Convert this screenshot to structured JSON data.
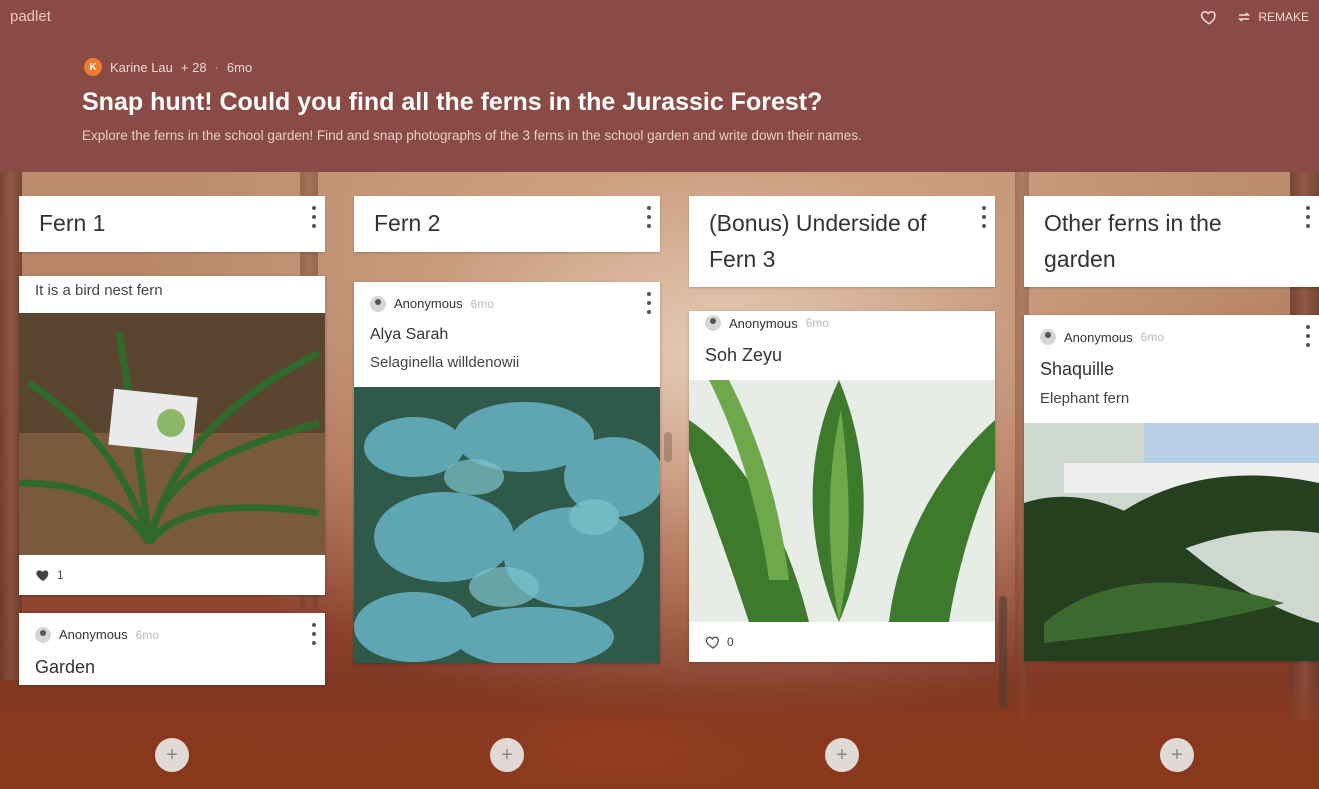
{
  "header": {
    "brand": "padlet",
    "remake_label": "REMAKE",
    "author": {
      "initial": "K",
      "name": "Karine Lau",
      "likes": "+ 28",
      "sep": "·",
      "age": "6mo"
    },
    "title": "Snap hunt! Could you find all the ferns in the Jurassic Forest?",
    "description": "Explore the ferns in the school garden! Find and snap photographs of the 3 ferns in the school garden and write down their names."
  },
  "columns": [
    {
      "title": "Fern 1",
      "cards": [
        {
          "body": "It is a bird nest fern",
          "likes": "1"
        },
        {
          "author": "Anonymous",
          "time": "6mo",
          "title": "Garden"
        }
      ]
    },
    {
      "title": "Fern 2",
      "cards": [
        {
          "author": "Anonymous",
          "time": "6mo",
          "title": "Alya Sarah",
          "body": "Selaginella willdenowii"
        }
      ]
    },
    {
      "title": "(Bonus) Underside of Fern 3",
      "cards": [
        {
          "author": "Anonymous",
          "time": "6mo",
          "title": "Soh Zeyu",
          "likes": "0"
        }
      ]
    },
    {
      "title": "Other ferns in the garden",
      "cards": [
        {
          "author": "Anonymous",
          "time": "6mo",
          "title": "Shaquille",
          "body": "Elephant fern"
        }
      ]
    }
  ],
  "add_label": "+",
  "colors": {
    "header_bg": "#8a4a45",
    "accent_orange": "#f07a2a"
  },
  "icons": [
    "heart-icon",
    "remake-icon",
    "kebab-menu-icon",
    "anonymous-avatar-icon",
    "add-post-icon"
  ]
}
